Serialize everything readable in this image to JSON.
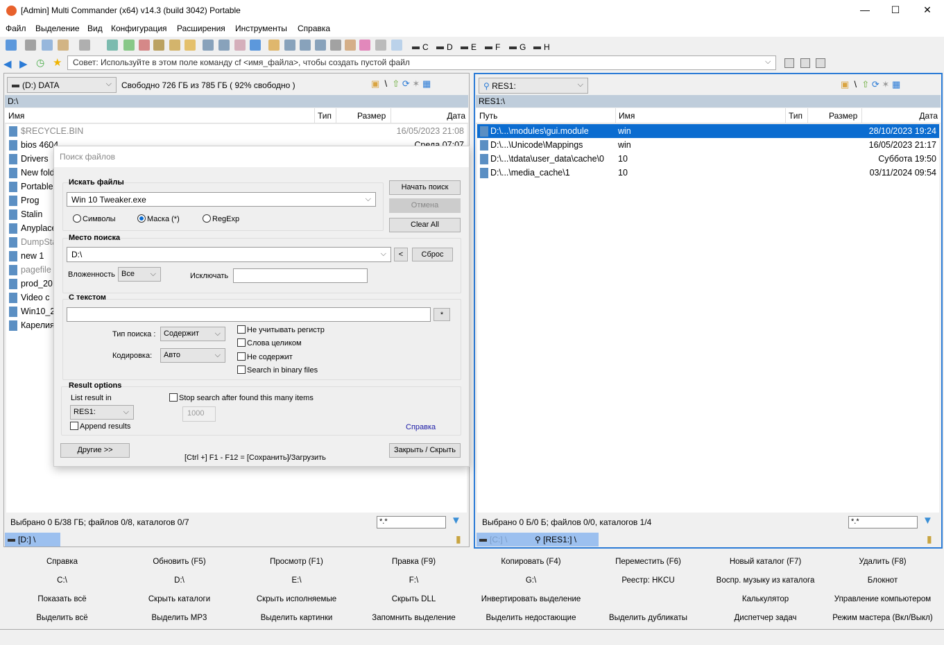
{
  "window": {
    "title": "[Admin] Multi Commander (x64)  v14.3 (build 3042) Portable",
    "minimize": "—",
    "maximize": "☐",
    "close": "✕"
  },
  "menu": [
    "Файл",
    "Выделение",
    "Вид",
    "Конфигурация",
    "Расширения",
    "Инструменты",
    "Справка"
  ],
  "toolbar": {
    "drives": [
      "C",
      "D",
      "E",
      "F",
      "G",
      "H"
    ]
  },
  "address": {
    "placeholder": "Совет: Используйте в этом поле команду cf <имя_файла>, чтобы создать пустой файл"
  },
  "left": {
    "drive": "(D:) DATA",
    "free": "Свободно 726 ГБ из 785 ГБ ( 92% свободно )",
    "path": "D:\\",
    "columns": [
      "Имя",
      "Тип",
      "Размер",
      "Дата"
    ],
    "files": [
      {
        "name": "$RECYCLE.BIN",
        "date": "16/05/2023 21:08",
        "dim": true
      },
      {
        "name": "bios 4604",
        "date": "Среда 07:07"
      },
      {
        "name": "Drivers"
      },
      {
        "name": "New folder"
      },
      {
        "name": "Portable"
      },
      {
        "name": "Prog"
      },
      {
        "name": "Stalin"
      },
      {
        "name": "Anyplace"
      },
      {
        "name": "DumpStack",
        "dim": true
      },
      {
        "name": "new 1"
      },
      {
        "name": "pagefile",
        "dim": true
      },
      {
        "name": "prod_20"
      },
      {
        "name": "Video c"
      },
      {
        "name": "Win10_2"
      },
      {
        "name": "Карелия"
      }
    ],
    "status": "Выбрано 0 Б/38 ГБ; файлов 0/8, каталогов 0/7",
    "filter": "*.*",
    "tab": "[D:] \\"
  },
  "right": {
    "drive": "RES1:",
    "path": "RES1:\\",
    "columns": [
      "Путь",
      "Имя",
      "Тип",
      "Размер",
      "Дата"
    ],
    "files": [
      {
        "path": "D:\\...\\modules\\gui.module",
        "name": "win",
        "date": "28/10/2023 19:24",
        "selected": true
      },
      {
        "path": "D:\\...\\Unicode\\Mappings",
        "name": "win",
        "date": "16/05/2023 21:17"
      },
      {
        "path": "D:\\...\\tdata\\user_data\\cache\\0",
        "name": "10",
        "date": "Суббота 19:50"
      },
      {
        "path": "D:\\...\\media_cache\\1",
        "name": "10",
        "date": "03/11/2024 09:54"
      }
    ],
    "status": "Выбрано 0 Б/0 Б; файлов 0/0, каталогов 1/4",
    "filter": "*.*",
    "tabs": [
      "[C:] \\",
      "[RES1:] \\"
    ]
  },
  "dialog": {
    "title": "Поиск файлов",
    "search_group": "Искать файлы",
    "search_value": "Win 10 Tweaker.exe",
    "modes": [
      "Символы",
      "Маска (*)",
      "RegExp"
    ],
    "mode_selected": 1,
    "start": "Начать поиск",
    "cancel": "Отмена",
    "clear": "Clear All",
    "location_group": "Место поиска",
    "location": "D:\\",
    "back": "<",
    "reset": "Сброс",
    "depth_label": "Вложенность",
    "depth": "Все",
    "exclude_label": "Исключать",
    "text_group": "С текстом",
    "star": "*",
    "type_label": "Тип поиска :",
    "type": "Содержит",
    "enc_label": "Кодировка:",
    "enc": "Авто",
    "checks": [
      "Не учитывать регистр",
      "Слова целиком",
      "Не содержит",
      "Search in binary files"
    ],
    "result_group": "Result options",
    "list_in_label": "List result in",
    "list_in": "RES1:",
    "append": "Append results",
    "stop": "Stop search after found this many items",
    "stop_count": "1000",
    "help": "Справка",
    "other": "Другие >>",
    "hint": "[Ctrl +] F1 - F12 = [Сохранить]/Загрузить",
    "close": "Закрыть / Скрыть"
  },
  "buttons": [
    [
      "Справка",
      "Обновить (F5)",
      "Просмотр (F1)",
      "Правка (F9)",
      "Копировать (F4)",
      "Переместить (F6)",
      "Новый каталог (F7)",
      "Удалить (F8)"
    ],
    [
      "C:\\",
      "D:\\",
      "E:\\",
      "F:\\",
      "G:\\",
      "Реестр: HKCU",
      "Воспр. музыку из каталога",
      "Блокнот"
    ],
    [
      "Показать всё",
      "Скрыть каталоги",
      "Скрыть исполняемые",
      "Скрыть DLL",
      "Инвертировать выделение",
      "",
      "Калькулятор",
      "Управление компьютером"
    ],
    [
      "Выделить всё",
      "Выделить MP3",
      "Выделить картинки",
      "Запомнить выделение",
      "Выделить недостающие",
      "Выделить дубликаты",
      "Диспетчер задач",
      "Режим мастера (Вкл/Выкл)"
    ]
  ]
}
